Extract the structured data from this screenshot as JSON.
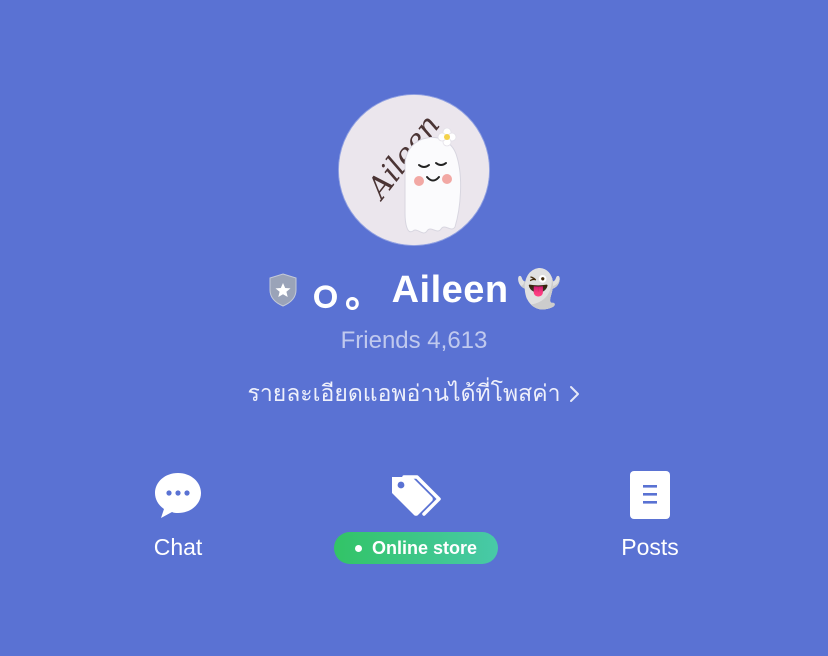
{
  "profile": {
    "avatar_lettering": "Aileen",
    "name_prefix": "ｏ。",
    "name": "Aileen",
    "name_emoji": "👻",
    "friends_label": "Friends 4,613",
    "status_message": "รายละเอียดแอพอ่านได้ที่โพสค่า"
  },
  "actions": {
    "chat_label": "Chat",
    "store_label": "Online store",
    "posts_label": "Posts"
  },
  "colors": {
    "background": "#5a72d3",
    "store_badge_start": "#32c466",
    "store_badge_end": "#48c9a8"
  },
  "icons": {
    "badge": "shield-star-icon",
    "chat": "chat-bubble-icon",
    "store": "price-tags-icon",
    "posts": "document-icon",
    "status_more": "chevron-right-icon"
  }
}
